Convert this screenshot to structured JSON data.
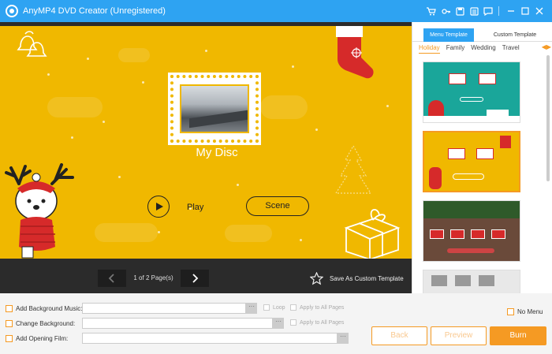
{
  "app": {
    "title": "AnyMP4 DVD Creator (Unregistered)"
  },
  "titlebar_icons": [
    "cart-icon",
    "key-icon",
    "save-icon",
    "menu-icon",
    "chat-icon",
    "minimize-icon",
    "maximize-icon",
    "close-icon"
  ],
  "preview": {
    "disc_title": "My Disc",
    "play_label": "Play",
    "scene_label": "Scene"
  },
  "navbar": {
    "page_info": "1 of 2 Page(s)",
    "save_template_label": "Save As Custom Template"
  },
  "right_panel": {
    "tabs": [
      "Menu Template",
      "Custom Template"
    ],
    "active_tab": "Menu Template",
    "categories": [
      "Holiday",
      "Family",
      "Wedding",
      "Travel"
    ],
    "active_category": "Holiday",
    "category_arrows": "◀▶"
  },
  "bottom": {
    "background_music_label": "Add Background Music:",
    "background_label": "Change Background:",
    "opening_film_label": "Add Opening Film:",
    "browse_label": "···",
    "loop_label": "Loop",
    "apply_all_label": "Apply to All Pages",
    "no_menu_label": "No Menu",
    "back_label": "Back",
    "preview_label": "Preview",
    "burn_label": "Burn"
  },
  "colors": {
    "title_bar": "#2ea3f2",
    "canvas_yellow": "#f0b800",
    "accent_orange": "#f59a23"
  }
}
